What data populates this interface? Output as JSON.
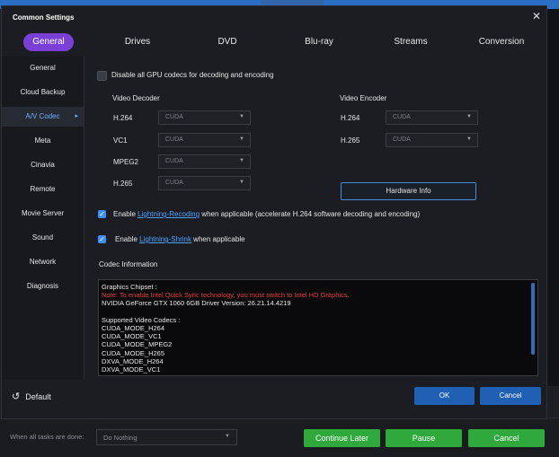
{
  "window": {
    "title": "Common Settings",
    "close_glyph": "✕"
  },
  "tabs": [
    {
      "label": "General",
      "active": true
    },
    {
      "label": "Drives"
    },
    {
      "label": "DVD"
    },
    {
      "label": "Blu-ray"
    },
    {
      "label": "Streams"
    },
    {
      "label": "Conversion"
    }
  ],
  "sidebar": {
    "items": [
      {
        "label": "General"
      },
      {
        "label": "Cloud Backup"
      },
      {
        "label": "A/V Codec",
        "active": true
      },
      {
        "label": "Meta"
      },
      {
        "label": "Cinavia"
      },
      {
        "label": "Remote"
      },
      {
        "label": "Movie Server"
      },
      {
        "label": "Sound"
      },
      {
        "label": "Network"
      },
      {
        "label": "Diagnosis"
      }
    ],
    "active_arrow": "▸"
  },
  "av_codec": {
    "disable_gpu": {
      "label": "Disable all GPU codecs for decoding and encoding",
      "checked": false
    },
    "decoder": {
      "heading": "Video Decoder",
      "rows": [
        {
          "label": "H.264",
          "value": "CUDA"
        },
        {
          "label": "VC1",
          "value": "CUDA"
        },
        {
          "label": "MPEG2",
          "value": "CUDA"
        },
        {
          "label": "H.265",
          "value": "CUDA"
        }
      ]
    },
    "encoder": {
      "heading": "Video Encoder",
      "rows": [
        {
          "label": "H.264",
          "value": "CUDA"
        },
        {
          "label": "H.265",
          "value": "CUDA"
        }
      ]
    },
    "hardware_info_button": "Hardware Info",
    "recoding": {
      "prefix": "Enable ",
      "link": "Lightning-Recoding",
      "suffix": " when applicable (accelerate H.264 software decoding and encoding)",
      "checked": true
    },
    "shrink": {
      "prefix": "Enable ",
      "link": "Lightning-Shrink",
      "suffix": " when applicable",
      "checked": true
    },
    "codec_info": {
      "heading": "Codec Information",
      "lines": [
        {
          "text": "Graphics Chipset :"
        },
        {
          "text": "Note: To enable Intel Quick Sync technology, you must switch to Intel HD Graphics.",
          "red": true
        },
        {
          "text": "NVIDIA GeForce GTX 1060 6GB Driver Version: 26.21.14.4219"
        },
        {
          "text": ""
        },
        {
          "text": "Supported Video Codecs :"
        },
        {
          "text": "CUDA_MODE_H264"
        },
        {
          "text": "CUDA_MODE_VC1"
        },
        {
          "text": "CUDA_MODE_MPEG2"
        },
        {
          "text": "CUDA_MODE_H265"
        },
        {
          "text": "DXVA_MODE_H264"
        },
        {
          "text": "DXVA_MODE_VC1"
        }
      ]
    },
    "caret_glyph": "▼",
    "check_glyph": "✓"
  },
  "footer": {
    "default_label": "Default",
    "default_icon": "↺",
    "ok_label": "OK",
    "cancel_label": "Cancel"
  },
  "taskbar": {
    "when_done_label": "When all tasks are done:",
    "when_done_value": "Do Nothing",
    "continue_later": "Continue Later",
    "pause": "Pause",
    "cancel": "Cancel"
  },
  "colors": {
    "active_tab": "#7a3fd6",
    "accent_blue": "#1f5fb4",
    "green": "#2fa83c",
    "link": "#4ea3ff",
    "warning_red": "#e43c3c"
  }
}
